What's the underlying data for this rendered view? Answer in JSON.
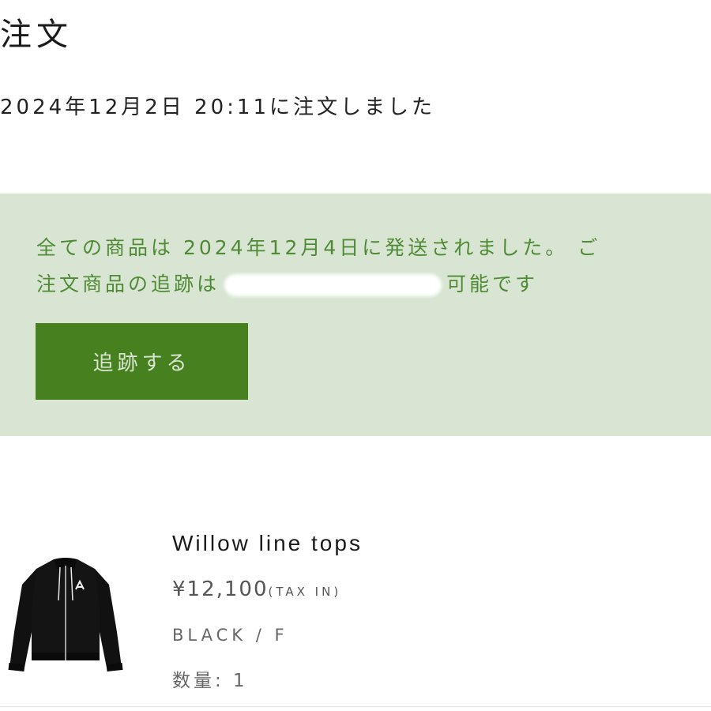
{
  "page": {
    "title": "注文",
    "order_date": "2024年12月2日 20:11に注文しました"
  },
  "shipping_notice": {
    "line1": "全ての商品は 2024年12月4日に発送されました。 ご",
    "line2_before": "注文商品の追跡は",
    "line2_after": "可能です",
    "track_button_label": "追跡する"
  },
  "product": {
    "name": "Willow line tops",
    "price": "¥12,100",
    "tax_note": "(TAX IN)",
    "variant": "BLACK / F",
    "quantity": "数量: 1",
    "image_icon": "black-cropped-zip-hoodie"
  },
  "colors": {
    "notice_background": "#d8e5d2",
    "notice_text": "#4f8a34",
    "button_background": "#46801f",
    "button_text": "#d8e5d2"
  }
}
